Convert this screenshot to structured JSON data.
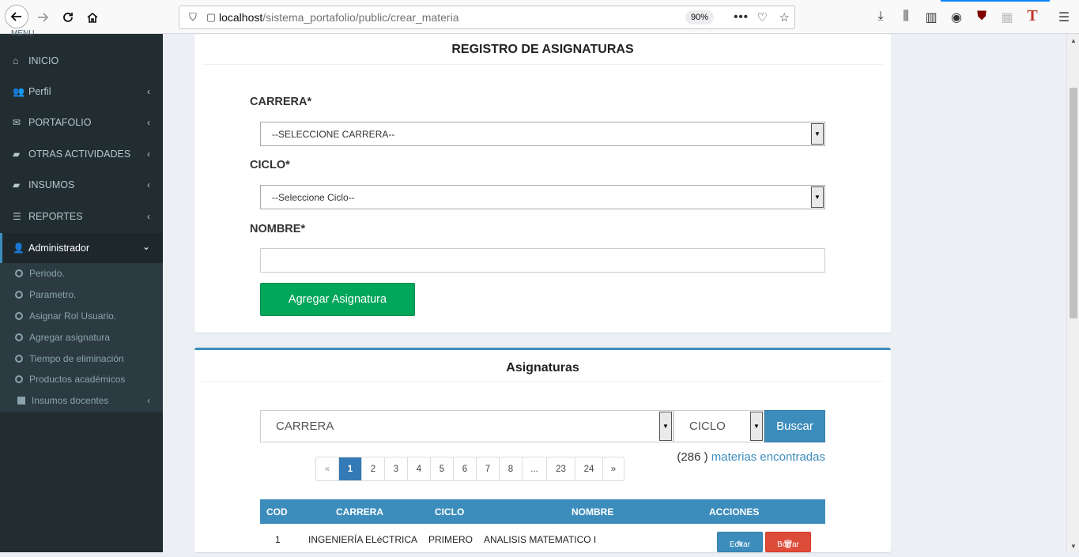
{
  "browser": {
    "url_host": "localhost",
    "url_path": "/sistema_portafolio/public/crear_materia",
    "zoom": "90%"
  },
  "sidebar": {
    "header_cut": "MENU",
    "items": [
      {
        "label": "INICIO",
        "icon": "home-icon"
      },
      {
        "label": "Perfil",
        "icon": "users-icon"
      },
      {
        "label": "PORTAFOLIO",
        "icon": "envelope-icon"
      },
      {
        "label": "OTRAS ACTIVIDADES",
        "icon": "folder-open-icon"
      },
      {
        "label": "INSUMOS",
        "icon": "folder-open-icon"
      },
      {
        "label": "REPORTES",
        "icon": "database-icon"
      },
      {
        "label": "Administrador",
        "icon": "user-icon"
      }
    ],
    "subitems": [
      {
        "label": "Periodo."
      },
      {
        "label": "Parametro."
      },
      {
        "label": "Asignar Rol Usuario."
      },
      {
        "label": "Agregar asignatura"
      },
      {
        "label": "Tiempo de eliminación"
      },
      {
        "label": "Productos académicos"
      },
      {
        "label": "Insumos docentes"
      }
    ]
  },
  "form": {
    "title": "REGISTRO DE ASIGNATURAS",
    "carrera_label": "CARRERA*",
    "carrera_value": "--SELECCIONE CARRERA--",
    "ciclo_label": "CICLO*",
    "ciclo_value": "--Seleccione Ciclo--",
    "nombre_label": "NOMBRE*",
    "nombre_value": "",
    "submit_label": "Agregar Asignatura"
  },
  "list": {
    "title": "Asignaturas",
    "filter_carrera": "CARRERA",
    "filter_ciclo": "CICLO",
    "search_label": "Buscar",
    "count_number": "(286 )",
    "count_text": "materias encontradas",
    "pages": [
      "«",
      "1",
      "2",
      "3",
      "4",
      "5",
      "6",
      "7",
      "8",
      "...",
      "23",
      "24",
      "»"
    ],
    "active_page": "1",
    "columns": [
      "COD",
      "CARRERA",
      "CICLO",
      "NOMBRE",
      "ACCIONES"
    ],
    "rows": [
      {
        "cod": "1",
        "carrera": "INGENIERÍA ELéCTRICA",
        "ciclo": "PRIMERO",
        "nombre": "ANALISIS MATEMATICO I",
        "edit": "Editar",
        "delete": "Borrar"
      }
    ]
  },
  "colors": {
    "sidebar_bg": "#222d32",
    "primary": "#3c8dbc",
    "success": "#00a65a",
    "danger": "#dd4b39"
  }
}
